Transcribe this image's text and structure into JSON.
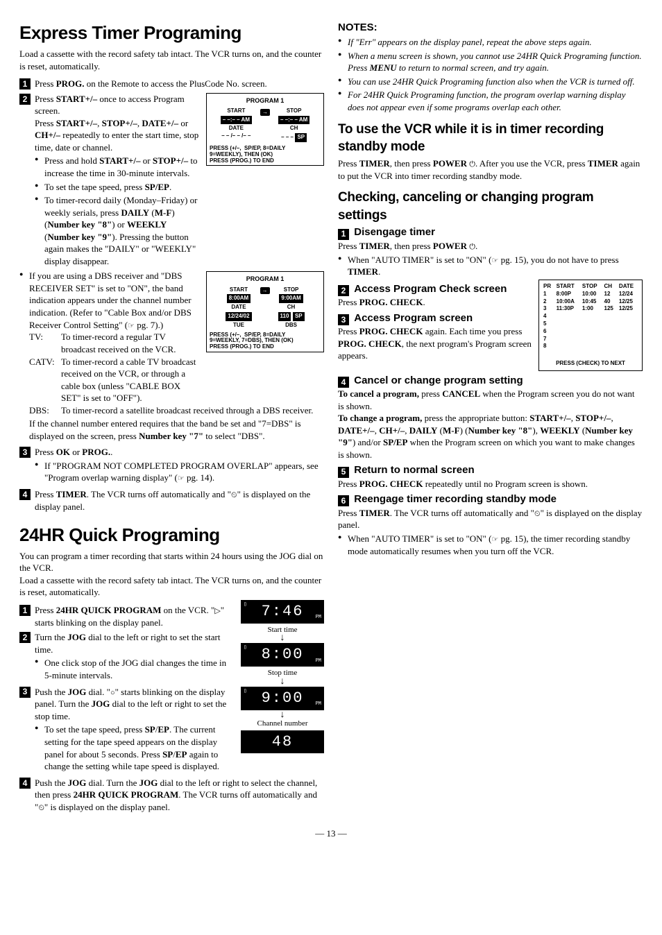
{
  "page_number": "— 13 —",
  "left": {
    "h1a": "Express Timer Programing",
    "intro_a": "Load a cassette with the record safety tab intact. The VCR turns on, and the counter is reset, automatically.",
    "step1a": "Press PROG. on the Remote to access the PlusCode No. screen.",
    "step2a": "Press START+/– once to access Program screen.",
    "step2a_cont": "Press START+/–, STOP+/–, DATE+/– or CH+/– repeatedly to enter the start time, stop time, date or channel.",
    "b2_1": "Press and hold START+/– or STOP+/– to increase the time in 30-minute intervals.",
    "b2_2": "To set the tape speed, press SP/EP.",
    "b2_3": "To timer-record daily (Monday–Friday) or weekly serials, press DAILY (M-F) (Number key \"8\") or WEEKLY (Number key \"9\"). Pressing the button again makes the \"DAILY\" or \"WEEKLY\" display disappear.",
    "b2_4": "If you are using a DBS receiver and \"DBS RECEIVER SET\" is set to \"ON\", the band indication appears under the channel number indication. (Refer to \"Cable Box and/or DBS Receiver Control Setting\" (",
    "b2_4_end": " pg. 7).)",
    "tv_lbl": "TV:",
    "tv_txt": "To timer-record a regular TV broadcast received on the VCR.",
    "catv_lbl": "CATV:",
    "catv_txt": "To timer-record a cable TV broadcast received on the VCR, or through a cable box (unless \"CABLE BOX SET\" is set to \"OFF\").",
    "dbs_lbl": "DBS:",
    "dbs_txt": "To timer-record a satellite broadcast received through a DBS receiver.",
    "cross_dbs": "If the channel number entered requires that the band be set and \"7=DBS\" is displayed on the screen, press Number key \"7\" to select \"DBS\".",
    "step3a": "Press OK or PROG..",
    "b3_1": "If \"PROGRAM NOT COMPLETED PROGRAM OVERLAP\" appears, see \"Program overlap warning display\" (",
    "b3_1_end": " pg. 14).",
    "step4a_1": "Press TIMER. The VCR turns off automatically and \"",
    "step4a_2": "\" is displayed on the display panel.",
    "h1b": "24HR Quick Programing",
    "intro_b1": "You can program a timer recording that starts within 24 hours using the JOG dial on the VCR.",
    "intro_b2": "Load a cassette with the record safety tab intact. The VCR turns on, and the counter is reset, automatically.",
    "step1b_1": "Press 24HR QUICK PROGRAM on the VCR. \"",
    "step1b_2": "\" starts blinking on the display panel.",
    "step2b": "Turn the JOG dial to the left or right to set the start time.",
    "b2b_1": "One click stop of the JOG dial changes the time in 5-minute intervals.",
    "step3b_1": "Push the JOG dial. \"",
    "step3b_2": "\" starts blinking on the display panel. Turn the JOG dial to the left or right to set the stop time.",
    "b3b_1": "To set the tape speed, press SP/EP. The current setting for the tape speed appears on the display panel for about 5 seconds. Press SP/EP again to change the setting while tape speed is displayed.",
    "step4b_1": "Push the JOG dial. Turn the JOG dial to the left or right to select the channel, then press 24HR QUICK PROGRAM. The VCR turns off automatically and \"",
    "step4b_2": "\" is displayed on the display panel.",
    "lcd_start": "Start time",
    "lcd_stop": "Stop time",
    "lcd_ch": "Channel number",
    "lcd_v1": "7:46",
    "lcd_v2": "8:00",
    "lcd_v3": "9:00",
    "lcd_v4": "48",
    "osd1": {
      "title": "PROGRAM 1",
      "start": "START",
      "stop": "STOP",
      "start_v": "– –:– – AM",
      "stop_v": "– –:– – AM",
      "date": "DATE",
      "ch": "CH",
      "date_v": "– – /– – /– –",
      "ch_v": "– – –",
      "sp": "SP",
      "msg": "PRESS (+/–,  SP/EP, 8=DAILY\n9=WEEKLY), THEN (OK)\nPRESS (PROG.) TO END"
    },
    "osd2": {
      "title": "PROGRAM 1",
      "start": "START",
      "stop": "STOP",
      "start_v": "8:00AM",
      "stop_v": "9:00AM",
      "date": "DATE",
      "ch": "CH",
      "date_v": "12/24/02",
      "ch_v": "110",
      "sp": "SP",
      "day": "TUE",
      "dbs": "DBS",
      "msg": "PRESS (+/–,  SP/EP, 8=DAILY\n9=WEEKLY, 7=DBS), THEN (OK)\nPRESS (PROG.) TO END"
    }
  },
  "right": {
    "notes_h": "NOTES:",
    "n1": "If \"Err\" appears on the display panel, repeat the above steps again.",
    "n2": "When a menu screen is shown, you cannot use 24HR Quick Programing function. Press MENU to return to normal screen, and try again.",
    "n3": "You can use 24HR Quick Programing function also when the VCR is turned off.",
    "n4": "For 24HR Quick Programing function, the program overlap warning display does not appear even if some programs overlap each other.",
    "h2a": "To use the VCR while it is in timer recording standby mode",
    "p_a1": "Press TIMER, then press POWER ",
    "p_a2": ". After you use the VCR, press TIMER again to put the VCR into timer recording standby mode.",
    "h2b": "Checking, canceling or changing program settings",
    "s1h": "Disengage timer",
    "s1_1": "Press TIMER, then press POWER ",
    "s1_2": ".",
    "s1b_1": "When \"AUTO TIMER\" is set to \"ON\" (",
    "s1b_2": " pg. 15), you do not have to press TIMER.",
    "s2h": "Access Program Check screen",
    "s2p": "Press PROG. CHECK.",
    "s3h": "Access Program screen",
    "s3p": "Press PROG. CHECK again. Each time you press PROG. CHECK, the next program's Program screen appears.",
    "s4h": "Cancel or change program setting",
    "s4p1": "To cancel a program, press CANCEL when the Program screen you do not want is shown.",
    "s4p2": "To change a program, press the appropriate button: START+/–, STOP+/–, DATE+/–, CH+/–, DAILY (M-F) (Number key \"8\"), WEEKLY (Number key \"9\") and/or SP/EP when the Program screen on which you want to make changes is shown.",
    "s5h": "Return to normal screen",
    "s5p": "Press PROG. CHECK repeatedly until no Program screen is shown.",
    "s6h": "Reengage timer recording standby mode",
    "s6p_1": "Press TIMER. The VCR turns off automatically and \"",
    "s6p_2": "\" is displayed on the display panel.",
    "s6b_1": "When \"AUTO TIMER\" is set to \"ON\" (",
    "s6b_2": " pg. 15), the timer recording standby mode automatically resumes when you turn off the VCR.",
    "sched": {
      "hdr": [
        "PR",
        "START",
        "STOP",
        "CH",
        "DATE"
      ],
      "rows": [
        [
          "1",
          "8:00P",
          "10:00",
          "12",
          "12/24"
        ],
        [
          "2",
          "10:00A",
          "10:45",
          "40",
          "12/25"
        ],
        [
          "3",
          "11:30P",
          "1:00",
          "125",
          "12/25"
        ],
        [
          "4",
          "",
          "",
          "",
          ""
        ],
        [
          "5",
          "",
          "",
          "",
          ""
        ],
        [
          "6",
          "",
          "",
          "",
          ""
        ],
        [
          "7",
          "",
          "",
          "",
          ""
        ],
        [
          "8",
          "",
          "",
          "",
          ""
        ]
      ],
      "foot": "PRESS (CHECK) TO NEXT"
    }
  }
}
